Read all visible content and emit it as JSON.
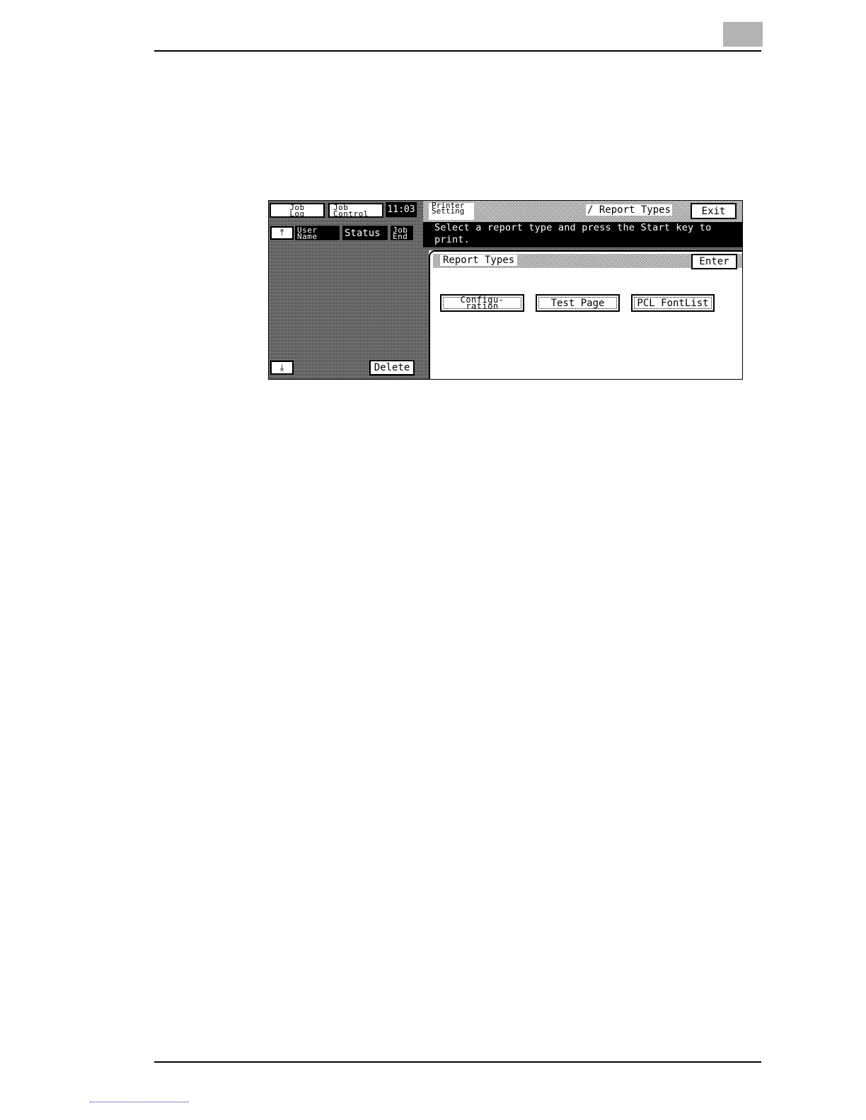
{
  "screen": {
    "left_pane": {
      "tabs": [
        {
          "line1": "Job",
          "line2": "Log"
        },
        {
          "line1": "Job",
          "line2": "Control"
        }
      ],
      "clock": "11:03",
      "columns": {
        "user_name": {
          "line1": "User",
          "line2": "Name"
        },
        "status": "Status",
        "job_end": {
          "line1": "Job",
          "line2": "End"
        }
      },
      "delete_label": "Delete",
      "scroll_top_glyph": "⤒",
      "scroll_bottom_glyph": "⤓"
    },
    "header": {
      "title_line1": "Printer",
      "title_line2": "Setting",
      "path": "/ Report Types",
      "exit_label": "Exit"
    },
    "message": "Select a report type and press the Start key to print.",
    "panel": {
      "title": "Report Types",
      "enter_label": "Enter",
      "options": [
        {
          "line1": "Configu-",
          "line2": "ration"
        },
        {
          "label": "Test Page"
        },
        {
          "label": "PCL FontList"
        }
      ]
    }
  },
  "icons": {
    "scroll_top": "scroll-to-top-icon",
    "scroll_bottom": "scroll-to-bottom-icon"
  }
}
